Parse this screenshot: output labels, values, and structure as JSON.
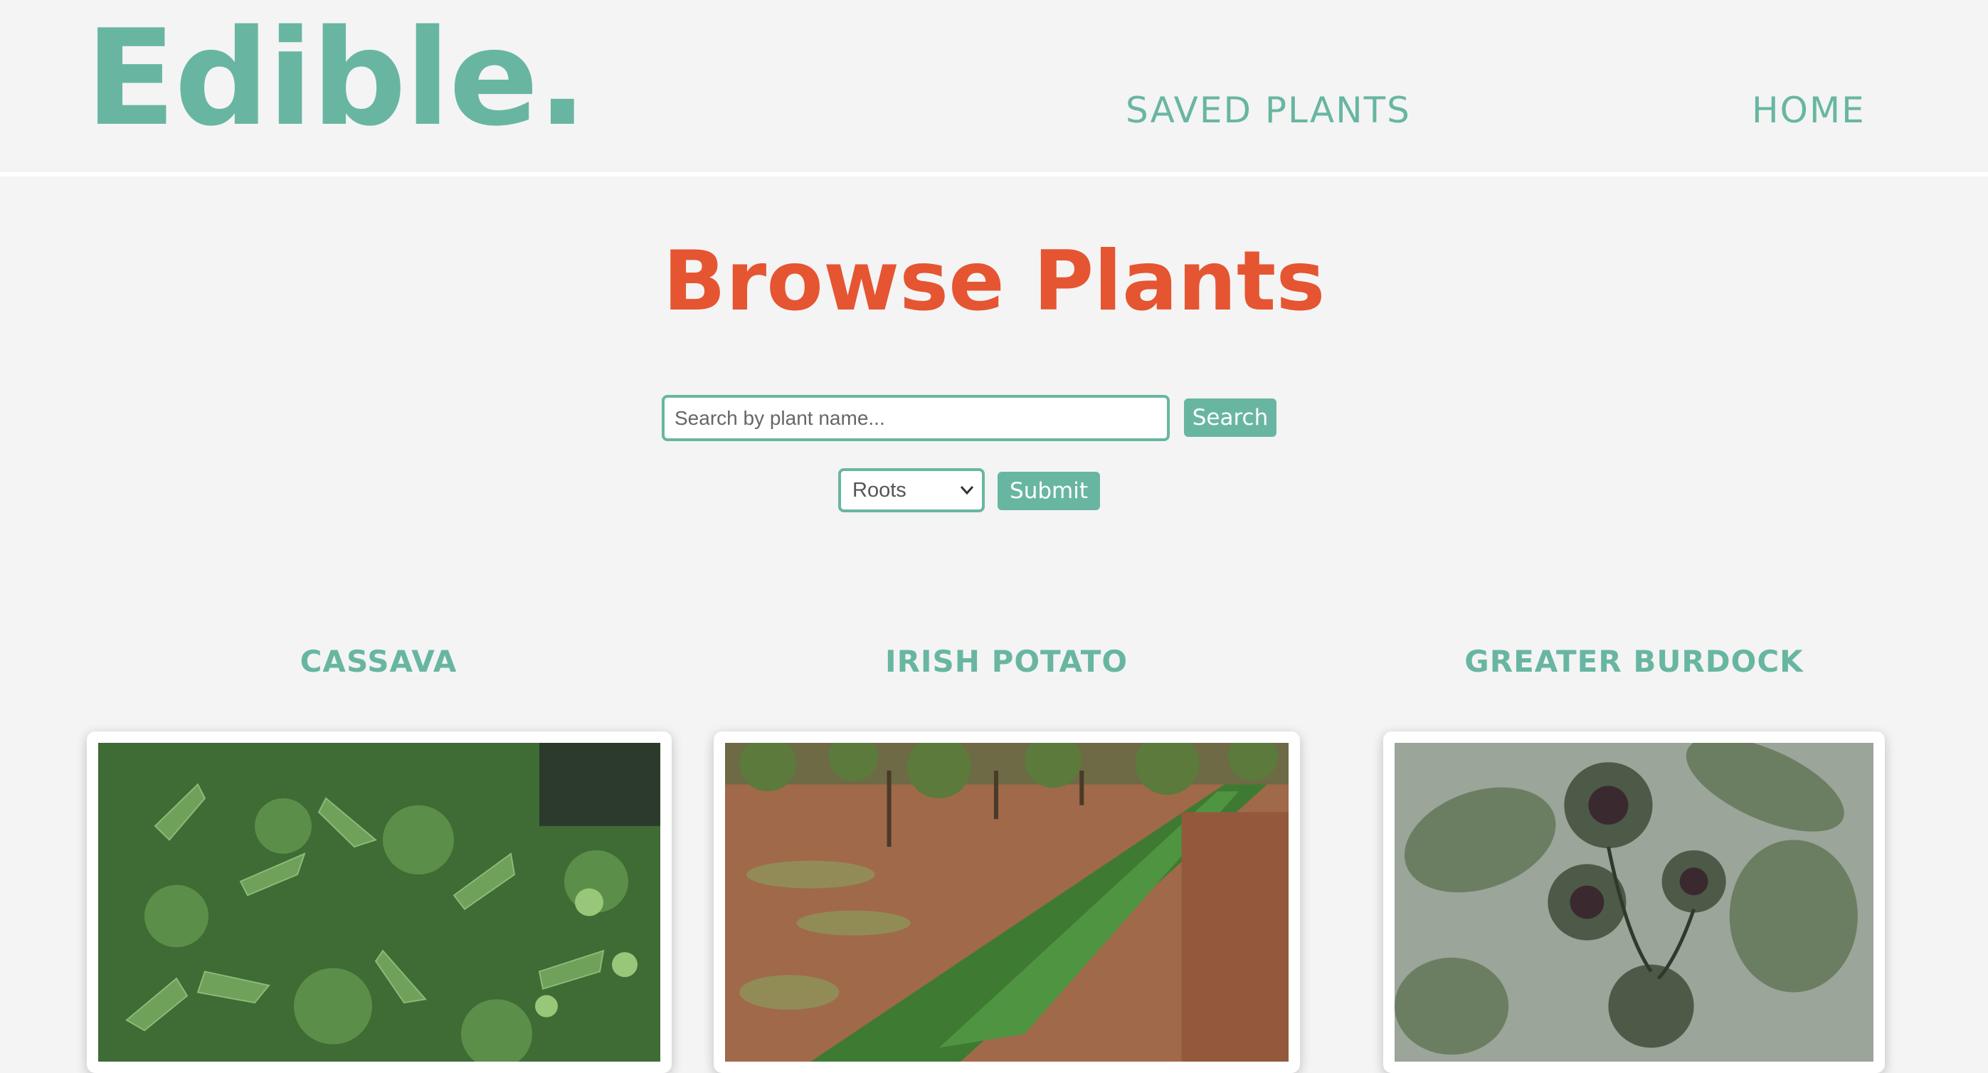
{
  "header": {
    "logo": "Edible.",
    "nav": {
      "saved": "SAVED PLANTS",
      "home": "HOME"
    }
  },
  "main": {
    "title": "Browse Plants",
    "search": {
      "placeholder": "Search by plant name...",
      "value": "",
      "button": "Search"
    },
    "filter": {
      "selected": "Roots",
      "button": "Submit"
    },
    "plants": [
      {
        "name": "CASSAVA"
      },
      {
        "name": "IRISH POTATO"
      },
      {
        "name": "GREATER BURDOCK"
      }
    ]
  },
  "colors": {
    "accent": "#68b6a2",
    "title": "#e55532",
    "background": "#f4f4f4"
  }
}
